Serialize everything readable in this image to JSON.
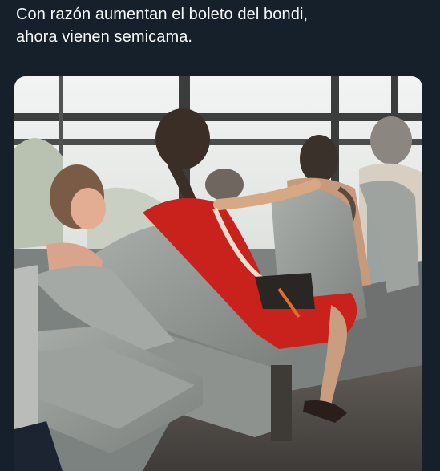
{
  "post": {
    "text_lines": [
      "Con razón aumentan el boleto del bondi,",
      "ahora vienen semicama."
    ]
  },
  "media": {
    "kind": "photo",
    "colors": {
      "app_background": "#15202b",
      "text": "#f7f9f9"
    }
  }
}
